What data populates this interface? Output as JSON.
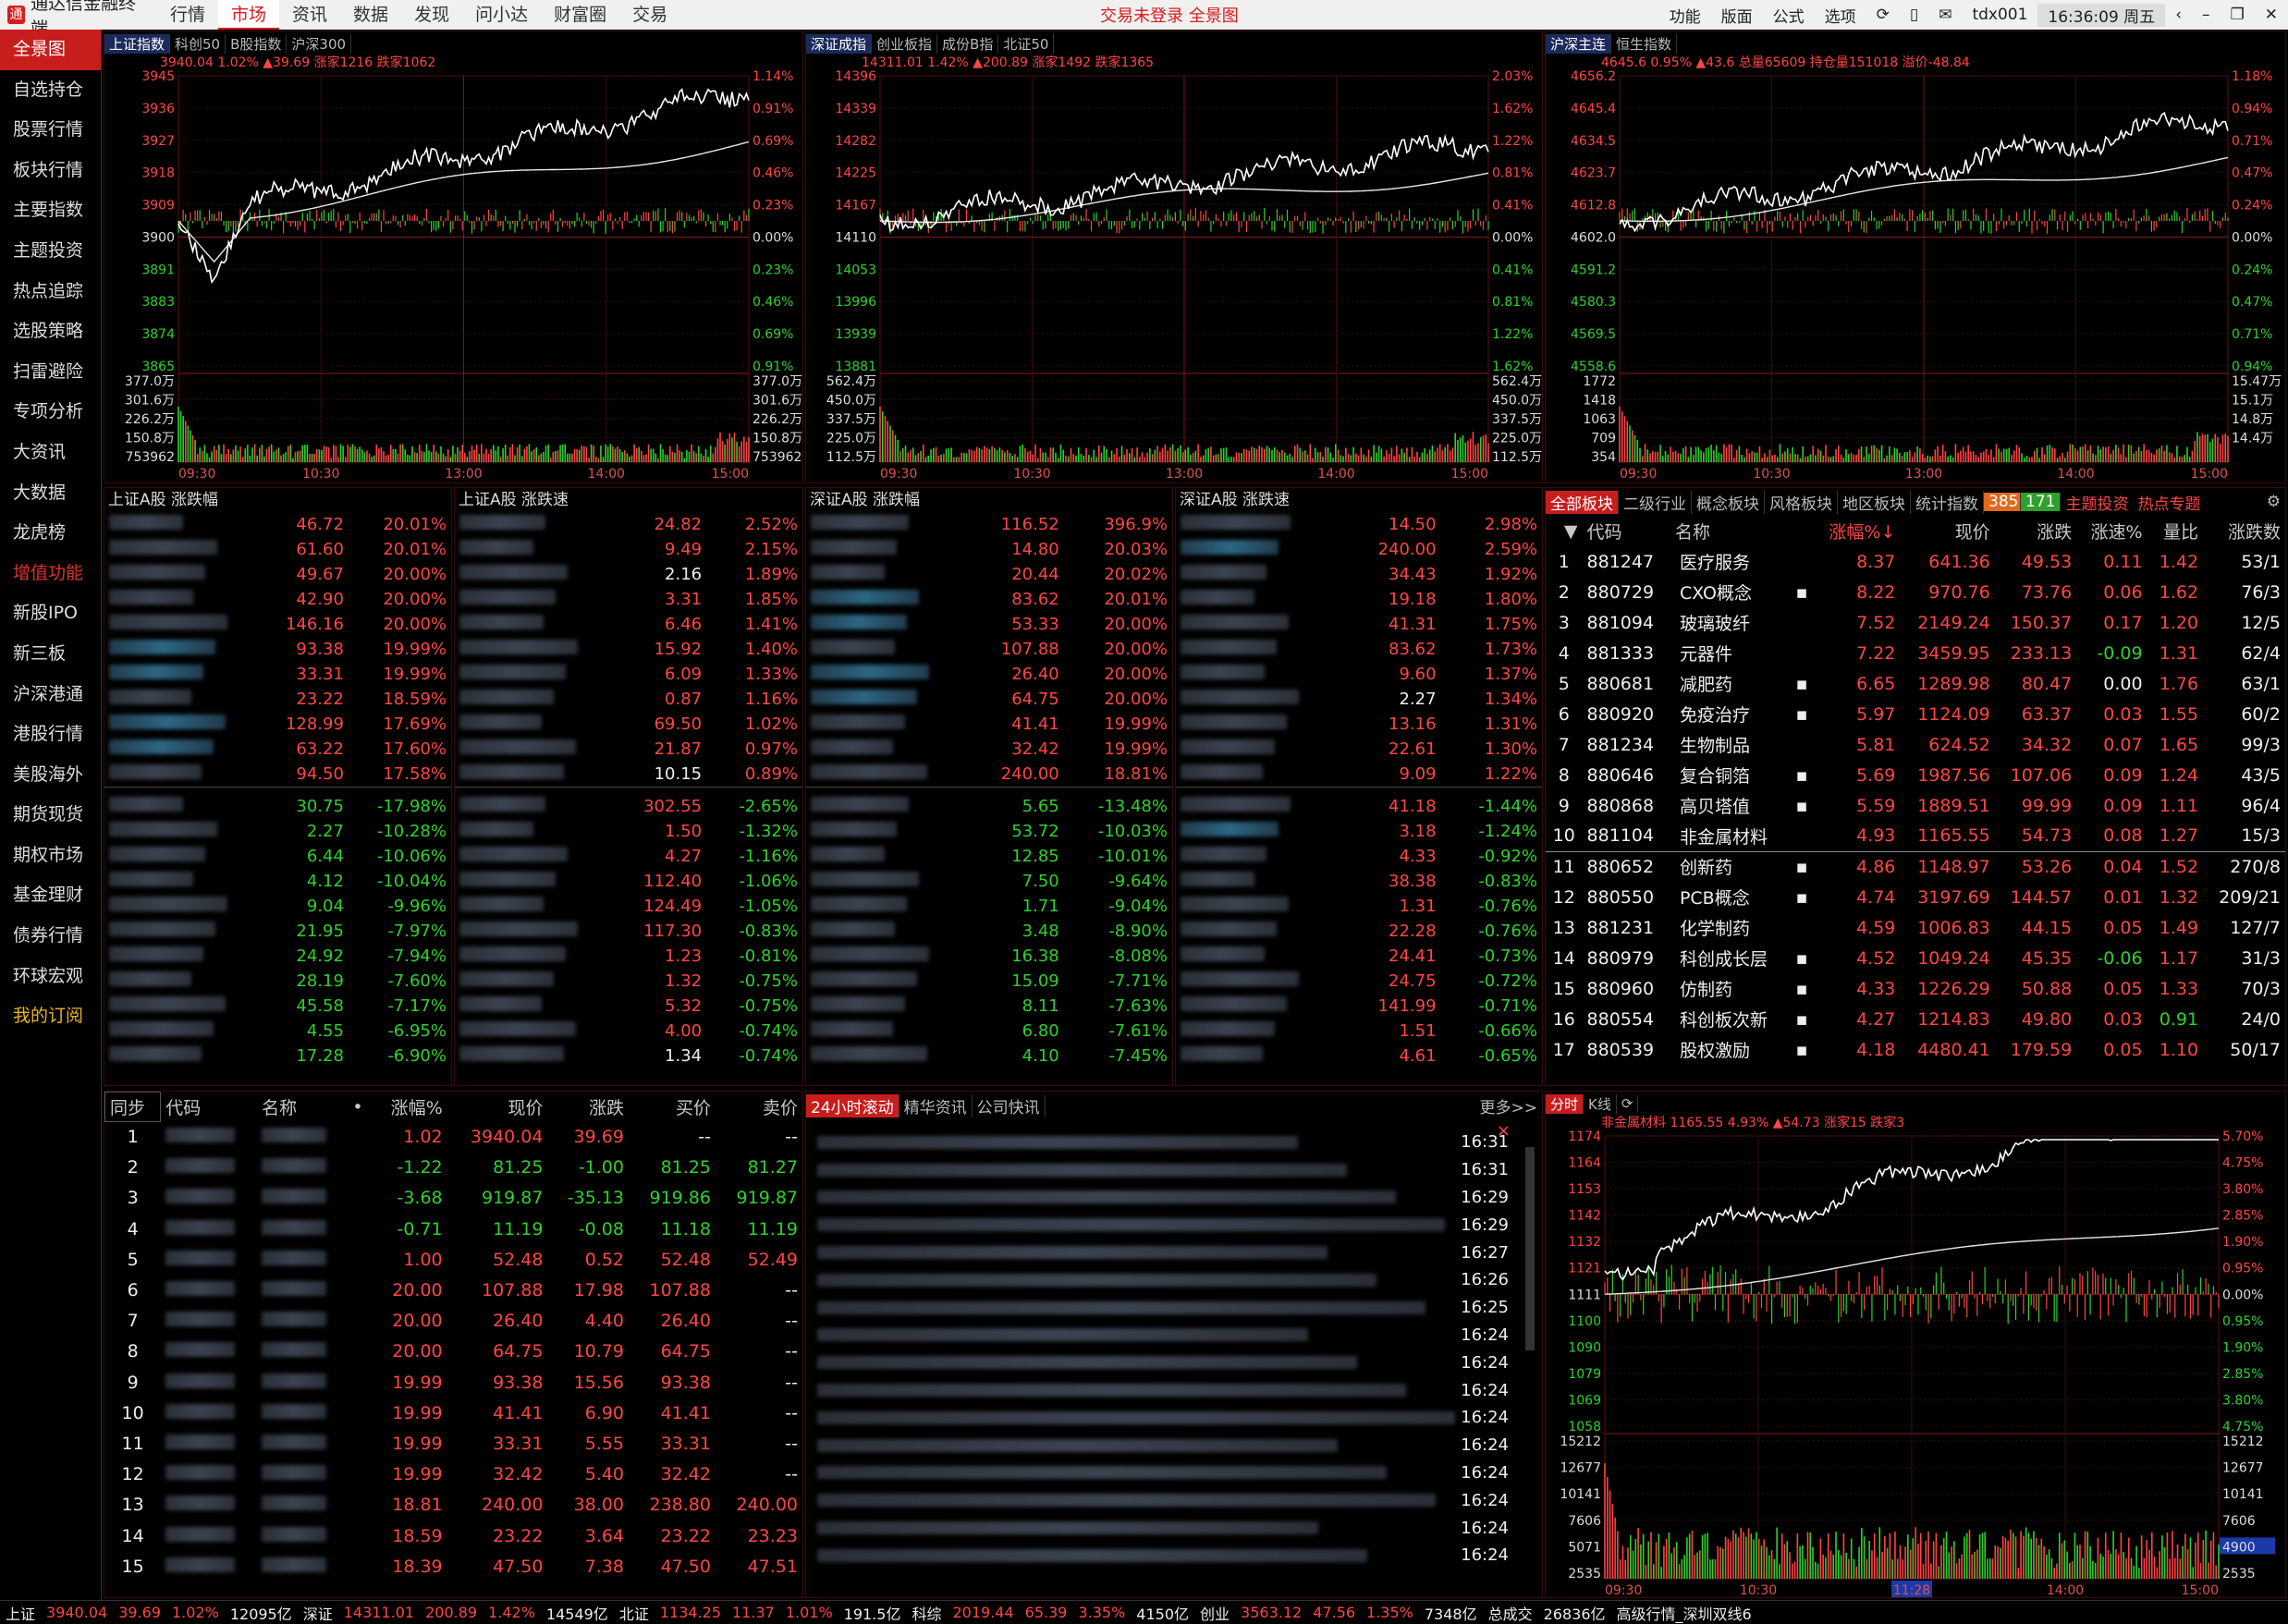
{
  "app": {
    "title": "通达信金融终端",
    "status_center": "交易未登录  全景图",
    "user": "tdx001",
    "clock": "16:36:09 周五"
  },
  "menu": [
    "行情",
    "市场",
    "资讯",
    "数据",
    "发现",
    "问小达",
    "财富圈",
    "交易"
  ],
  "toolbar_right": [
    "功能",
    "版面",
    "公式",
    "选项"
  ],
  "sidebar": [
    "全景图",
    "自选持仓",
    "股票行情",
    "板块行情",
    "主要指数",
    "主题投资",
    "热点追踪",
    "选股策略",
    "扫雷避险",
    "专项分析",
    "大资讯",
    "大数据",
    "龙虎榜",
    "增值功能",
    "新股IPO",
    "新三板",
    "沪深港通",
    "港股行情",
    "美股海外",
    "期货现货",
    "期权市场",
    "基金理财",
    "债券行情",
    "环球宏观",
    "我的订阅"
  ],
  "index_panels": [
    {
      "tabs": [
        "上证指数",
        "科创50",
        "B股指数",
        "沪深300"
      ],
      "info": "3940.04 1.02% ▲39.69 涨家1216 跌家1062",
      "price_left": [
        "3945",
        "3936",
        "3927",
        "3918",
        "3909",
        "3900",
        "3891",
        "3883",
        "3874",
        "3865"
      ],
      "pct_right": [
        "1.14%",
        "0.91%",
        "0.69%",
        "0.46%",
        "0.23%",
        "0.00%",
        "0.23%",
        "0.46%",
        "0.69%",
        "0.91%"
      ],
      "vol_left": [
        "377.0万",
        "301.6万",
        "226.2万",
        "150.8万",
        "753962"
      ],
      "vol_right": [
        "377.0万",
        "301.6万",
        "226.2万",
        "150.8万",
        "753962"
      ],
      "times": [
        "09:30",
        "10:30",
        "13:00",
        "14:00",
        "15:00"
      ]
    },
    {
      "tabs": [
        "深证成指",
        "创业板指",
        "成份B指",
        "北证50"
      ],
      "info": "14311.01 1.42% ▲200.89 涨家1492 跌家1365",
      "price_left": [
        "14396",
        "14339",
        "14282",
        "14225",
        "14167",
        "14110",
        "14053",
        "13996",
        "13939",
        "13881"
      ],
      "pct_right": [
        "2.03%",
        "1.62%",
        "1.22%",
        "0.81%",
        "0.41%",
        "0.00%",
        "0.41%",
        "0.81%",
        "1.22%",
        "1.62%"
      ],
      "vol_left": [
        "562.4万",
        "450.0万",
        "337.5万",
        "225.0万",
        "112.5万"
      ],
      "vol_right": [
        "562.4万",
        "450.0万",
        "337.5万",
        "225.0万",
        "112.5万"
      ],
      "times": [
        "09:30",
        "10:30",
        "13:00",
        "14:00",
        "15:00"
      ]
    },
    {
      "tabs": [
        "沪深主连",
        "恒生指数"
      ],
      "info": "4645.6 0.95% ▲43.6 总量65609 持仓量151018 溢价-48.84",
      "price_left": [
        "4656.2",
        "4645.4",
        "4634.5",
        "4623.7",
        "4612.8",
        "4602.0",
        "4591.2",
        "4580.3",
        "4569.5",
        "4558.6"
      ],
      "pct_right": [
        "1.18%",
        "0.94%",
        "0.71%",
        "0.47%",
        "0.24%",
        "0.00%",
        "0.24%",
        "0.47%",
        "0.71%",
        "0.94%"
      ],
      "vol_left": [
        "1772",
        "1418",
        "1063",
        "709",
        "354"
      ],
      "vol_right": [
        "15.47万",
        "15.1万",
        "14.8万",
        "14.4万",
        ""
      ],
      "times": [
        "09:30",
        "10:30",
        "13:00",
        "14:00",
        "15:00"
      ]
    }
  ],
  "rank_panels": [
    {
      "title": "上证A股 涨跌幅",
      "rows": [
        [
          "46.72",
          "20.01%"
        ],
        [
          "61.60",
          "20.01%"
        ],
        [
          "49.67",
          "20.00%"
        ],
        [
          "42.90",
          "20.00%"
        ],
        [
          "146.16",
          "20.00%"
        ],
        [
          "93.38",
          "19.99%"
        ],
        [
          "33.31",
          "19.99%"
        ],
        [
          "23.22",
          "18.59%"
        ],
        [
          "128.99",
          "17.69%"
        ],
        [
          "63.22",
          "17.60%"
        ],
        [
          "94.50",
          "17.58%"
        ]
      ],
      "rows_down": [
        [
          "30.75",
          "-17.98%"
        ],
        [
          "2.27",
          "-10.28%"
        ],
        [
          "6.44",
          "-10.06%"
        ],
        [
          "4.12",
          "-10.04%"
        ],
        [
          "9.04",
          "-9.96%"
        ],
        [
          "21.95",
          "-7.97%"
        ],
        [
          "24.92",
          "-7.94%"
        ],
        [
          "28.19",
          "-7.60%"
        ],
        [
          "45.58",
          "-7.17%"
        ],
        [
          "4.55",
          "-6.95%"
        ],
        [
          "17.28",
          "-6.90%"
        ]
      ]
    },
    {
      "title": "上证A股 涨跌速",
      "rows": [
        [
          "24.82",
          "2.52%"
        ],
        [
          "9.49",
          "2.15%"
        ],
        [
          "2.16",
          "1.89%"
        ],
        [
          "3.31",
          "1.85%"
        ],
        [
          "6.46",
          "1.41%"
        ],
        [
          "15.92",
          "1.40%"
        ],
        [
          "6.09",
          "1.33%"
        ],
        [
          "0.87",
          "1.16%"
        ],
        [
          "69.50",
          "1.02%"
        ],
        [
          "21.87",
          "0.97%"
        ],
        [
          "10.15",
          "0.89%"
        ]
      ],
      "rows_down": [
        [
          "302.55",
          "-2.65%"
        ],
        [
          "1.50",
          "-1.32%"
        ],
        [
          "4.27",
          "-1.16%"
        ],
        [
          "112.40",
          "-1.06%"
        ],
        [
          "124.49",
          "-1.05%"
        ],
        [
          "117.30",
          "-0.83%"
        ],
        [
          "1.23",
          "-0.81%"
        ],
        [
          "1.32",
          "-0.75%"
        ],
        [
          "5.32",
          "-0.75%"
        ],
        [
          "4.00",
          "-0.74%"
        ],
        [
          "1.34",
          "-0.74%"
        ]
      ]
    },
    {
      "title": "深证A股 涨跌幅",
      "rows": [
        [
          "116.52",
          "396.9%"
        ],
        [
          "14.80",
          "20.03%"
        ],
        [
          "20.44",
          "20.02%"
        ],
        [
          "83.62",
          "20.01%"
        ],
        [
          "53.33",
          "20.00%"
        ],
        [
          "107.88",
          "20.00%"
        ],
        [
          "26.40",
          "20.00%"
        ],
        [
          "64.75",
          "20.00%"
        ],
        [
          "41.41",
          "19.99%"
        ],
        [
          "32.42",
          "19.99%"
        ],
        [
          "240.00",
          "18.81%"
        ]
      ],
      "rows_down": [
        [
          "5.65",
          "-13.48%"
        ],
        [
          "53.72",
          "-10.03%"
        ],
        [
          "12.85",
          "-10.01%"
        ],
        [
          "7.50",
          "-9.64%"
        ],
        [
          "1.71",
          "-9.04%"
        ],
        [
          "3.48",
          "-8.90%"
        ],
        [
          "16.38",
          "-8.08%"
        ],
        [
          "15.09",
          "-7.71%"
        ],
        [
          "8.11",
          "-7.63%"
        ],
        [
          "6.80",
          "-7.61%"
        ],
        [
          "4.10",
          "-7.45%"
        ]
      ]
    },
    {
      "title": "深证A股 涨跌速",
      "rows": [
        [
          "14.50",
          "2.98%"
        ],
        [
          "240.00",
          "2.59%"
        ],
        [
          "34.43",
          "1.92%"
        ],
        [
          "19.18",
          "1.80%"
        ],
        [
          "41.31",
          "1.75%"
        ],
        [
          "83.62",
          "1.73%"
        ],
        [
          "9.60",
          "1.37%"
        ],
        [
          "2.27",
          "1.34%"
        ],
        [
          "13.16",
          "1.31%"
        ],
        [
          "22.61",
          "1.30%"
        ],
        [
          "9.09",
          "1.22%"
        ]
      ],
      "rows_down": [
        [
          "41.18",
          "-1.44%"
        ],
        [
          "3.18",
          "-1.24%"
        ],
        [
          "4.33",
          "-0.92%"
        ],
        [
          "38.38",
          "-0.83%"
        ],
        [
          "1.31",
          "-0.76%"
        ],
        [
          "22.28",
          "-0.76%"
        ],
        [
          "24.41",
          "-0.73%"
        ],
        [
          "24.75",
          "-0.72%"
        ],
        [
          "141.99",
          "-0.71%"
        ],
        [
          "1.51",
          "-0.66%"
        ],
        [
          "4.61",
          "-0.65%"
        ]
      ]
    }
  ],
  "sector": {
    "tabs": [
      "全部板块",
      "二级行业",
      "概念板块",
      "风格板块",
      "地区板块",
      "统计指数"
    ],
    "up_count": "385",
    "down_count": "171",
    "links": [
      "主题投资",
      "热点专题"
    ],
    "headers": [
      "代码",
      "名称",
      "",
      "涨幅%↓",
      "现价",
      "涨跌",
      "涨速%",
      "量比",
      "涨跌数"
    ],
    "rows": [
      [
        "1",
        "881247",
        "医疗服务",
        "",
        "8.37",
        "641.36",
        "49.53",
        "0.11",
        "1.42",
        "53/1"
      ],
      [
        "2",
        "880729",
        "CXO概念",
        "▪",
        "8.22",
        "970.76",
        "73.76",
        "0.06",
        "1.62",
        "76/3"
      ],
      [
        "3",
        "881094",
        "玻璃玻纤",
        "",
        "7.52",
        "2149.24",
        "150.37",
        "0.17",
        "1.20",
        "12/5"
      ],
      [
        "4",
        "881333",
        "元器件",
        "",
        "7.22",
        "3459.95",
        "233.13",
        "-0.09",
        "1.31",
        "62/4"
      ],
      [
        "5",
        "880681",
        "减肥药",
        "▪",
        "6.65",
        "1289.98",
        "80.47",
        "0.00",
        "1.76",
        "63/1"
      ],
      [
        "6",
        "880920",
        "免疫治疗",
        "▪",
        "5.97",
        "1124.09",
        "63.37",
        "0.03",
        "1.55",
        "60/2"
      ],
      [
        "7",
        "881234",
        "生物制品",
        "",
        "5.81",
        "624.52",
        "34.32",
        "0.07",
        "1.65",
        "99/3"
      ],
      [
        "8",
        "880646",
        "复合铜箔",
        "▪",
        "5.69",
        "1987.56",
        "107.06",
        "0.09",
        "1.24",
        "43/5"
      ],
      [
        "9",
        "880868",
        "高贝塔值",
        "▪",
        "5.59",
        "1889.51",
        "99.99",
        "0.09",
        "1.11",
        "96/4"
      ],
      [
        "10",
        "881104",
        "非金属材料",
        "",
        "4.93",
        "1165.55",
        "54.73",
        "0.08",
        "1.27",
        "15/3"
      ],
      [
        "11",
        "880652",
        "创新药",
        "▪",
        "4.86",
        "1148.97",
        "53.26",
        "0.04",
        "1.52",
        "270/8"
      ],
      [
        "12",
        "880550",
        "PCB概念",
        "▪",
        "4.74",
        "3197.69",
        "144.57",
        "0.01",
        "1.32",
        "209/21"
      ],
      [
        "13",
        "881231",
        "化学制药",
        "",
        "4.59",
        "1006.83",
        "44.15",
        "0.05",
        "1.49",
        "127/7"
      ],
      [
        "14",
        "880979",
        "科创成长层",
        "▪",
        "4.52",
        "1049.24",
        "45.35",
        "-0.06",
        "1.17",
        "31/3"
      ],
      [
        "15",
        "880960",
        "仿制药",
        "▪",
        "4.33",
        "1226.29",
        "50.88",
        "0.05",
        "1.33",
        "70/3"
      ],
      [
        "16",
        "880554",
        "科创板次新",
        "▪",
        "4.27",
        "1214.83",
        "49.80",
        "0.03",
        "0.91",
        "24/0"
      ],
      [
        "17",
        "880539",
        "股权激励",
        "▪",
        "4.18",
        "4480.41",
        "179.59",
        "0.05",
        "1.10",
        "50/17"
      ]
    ]
  },
  "watch": {
    "headers": [
      "同步",
      "代码",
      "名称",
      "•",
      "涨幅%",
      "现价",
      "涨跌",
      "买价",
      "卖价"
    ],
    "rows": [
      [
        "1",
        "1.02",
        "3940.04",
        "39.69",
        "--",
        "--"
      ],
      [
        "2",
        "-1.22",
        "81.25",
        "-1.00",
        "81.25",
        "81.27"
      ],
      [
        "3",
        "-3.68",
        "919.87",
        "-35.13",
        "919.86",
        "919.87"
      ],
      [
        "4",
        "-0.71",
        "11.19",
        "-0.08",
        "11.18",
        "11.19"
      ],
      [
        "5",
        "1.00",
        "52.48",
        "0.52",
        "52.48",
        "52.49"
      ],
      [
        "6",
        "20.00",
        "107.88",
        "17.98",
        "107.88",
        "--"
      ],
      [
        "7",
        "20.00",
        "26.40",
        "4.40",
        "26.40",
        "--"
      ],
      [
        "8",
        "20.00",
        "64.75",
        "10.79",
        "64.75",
        "--"
      ],
      [
        "9",
        "19.99",
        "93.38",
        "15.56",
        "93.38",
        "--"
      ],
      [
        "10",
        "19.99",
        "41.41",
        "6.90",
        "41.41",
        "--"
      ],
      [
        "11",
        "19.99",
        "33.31",
        "5.55",
        "33.31",
        "--"
      ],
      [
        "12",
        "19.99",
        "32.42",
        "5.40",
        "32.42",
        "--"
      ],
      [
        "13",
        "18.81",
        "240.00",
        "38.00",
        "238.80",
        "240.00"
      ],
      [
        "14",
        "18.59",
        "23.22",
        "3.64",
        "23.22",
        "23.23"
      ],
      [
        "15",
        "18.39",
        "47.50",
        "7.38",
        "47.50",
        "47.51"
      ]
    ]
  },
  "news": {
    "tabs": [
      "24小时滚动",
      "精华资讯",
      "公司快讯"
    ],
    "more": "更多>>",
    "times": [
      "16:31",
      "16:31",
      "16:29",
      "16:29",
      "16:27",
      "16:26",
      "16:25",
      "16:24",
      "16:24",
      "16:24",
      "16:24",
      "16:24",
      "16:24",
      "16:24",
      "16:24",
      "16:24"
    ]
  },
  "mini": {
    "tabs": [
      "分时",
      "K线"
    ],
    "info": "非金属材料  1165.55 4.93% ▲54.73 涨家15 跌家3",
    "price_left": [
      "1174",
      "1164",
      "1153",
      "1142",
      "1132",
      "1121",
      "1111",
      "1100",
      "1090",
      "1079",
      "1069",
      "1058"
    ],
    "pct_right": [
      "5.70%",
      "4.75%",
      "3.80%",
      "2.85%",
      "1.90%",
      "0.95%",
      "0.00%",
      "0.95%",
      "1.90%",
      "2.85%",
      "3.80%",
      "4.75%"
    ],
    "vol_left": [
      "15212",
      "12677",
      "10141",
      "7606",
      "5071",
      "2535"
    ],
    "vol_right": [
      "15212",
      "12677",
      "10141",
      "7606",
      "4900",
      "2535"
    ],
    "times": [
      "09:30",
      "10:30",
      "11:28",
      "14:00",
      "15:00"
    ]
  },
  "bottombar": [
    {
      "t": "上证",
      "c": "white"
    },
    {
      "t": "3940.04",
      "c": "red"
    },
    {
      "t": "39.69",
      "c": "red"
    },
    {
      "t": "1.02%",
      "c": "red"
    },
    {
      "t": "12095亿",
      "c": "white"
    },
    {
      "t": "深证",
      "c": "white"
    },
    {
      "t": "14311.01",
      "c": "red"
    },
    {
      "t": "200.89",
      "c": "red"
    },
    {
      "t": "1.42%",
      "c": "red"
    },
    {
      "t": "14549亿",
      "c": "white"
    },
    {
      "t": "北证",
      "c": "white"
    },
    {
      "t": "1134.25",
      "c": "red"
    },
    {
      "t": "11.37",
      "c": "red"
    },
    {
      "t": "1.01%",
      "c": "red"
    },
    {
      "t": "191.5亿",
      "c": "white"
    },
    {
      "t": "科综",
      "c": "white"
    },
    {
      "t": "2019.44",
      "c": "red"
    },
    {
      "t": "65.39",
      "c": "red"
    },
    {
      "t": "3.35%",
      "c": "red"
    },
    {
      "t": "4150亿",
      "c": "white"
    },
    {
      "t": "创业",
      "c": "white"
    },
    {
      "t": "3563.12",
      "c": "red"
    },
    {
      "t": "47.56",
      "c": "red"
    },
    {
      "t": "1.35%",
      "c": "red"
    },
    {
      "t": "7348亿",
      "c": "white"
    },
    {
      "t": "总成交",
      "c": "white"
    },
    {
      "t": "26836亿",
      "c": "white"
    },
    {
      "t": "高级行情_深圳双线6",
      "c": "white"
    }
  ]
}
